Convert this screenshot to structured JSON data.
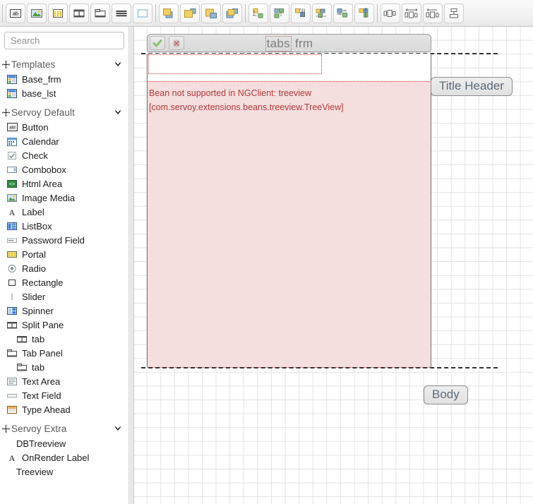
{
  "toolbar": {
    "groups": [
      {
        "name": "element-tools",
        "buttons": [
          {
            "name": "button-tool",
            "icon": "ab-button-icon",
            "label": "Button"
          },
          {
            "name": "image-tool",
            "icon": "image-media-icon",
            "label": "Image Media"
          },
          {
            "name": "portal-tool",
            "icon": "portal-icon",
            "label": "Portal"
          },
          {
            "name": "split-pane-tool",
            "icon": "split-pane-icon",
            "label": "Split Pane"
          },
          {
            "name": "tab-panel-tool",
            "icon": "tab-panel-icon",
            "label": "Tab Panel"
          },
          {
            "name": "text-area-tool",
            "icon": "text-area-icon",
            "label": "Text Area"
          }
        ]
      },
      {
        "name": "selection-tools",
        "buttons": [
          {
            "name": "rectangle-tool",
            "icon": "rectangle-icon",
            "label": "Rectangle"
          }
        ]
      },
      {
        "name": "z-order-tools",
        "buttons": [
          {
            "name": "bring-to-front-button",
            "icon": "bring-to-front-icon",
            "label": "Bring to front"
          },
          {
            "name": "bring-forward-button",
            "icon": "bring-forward-icon",
            "label": "Bring forward"
          },
          {
            "name": "send-backward-button",
            "icon": "send-backward-icon",
            "label": "Send backward"
          },
          {
            "name": "send-to-back-button",
            "icon": "send-to-back-icon",
            "label": "Send to back"
          }
        ]
      },
      {
        "name": "align-tools",
        "buttons": [
          {
            "name": "align-left-button",
            "icon": "align-left-icon",
            "label": "Align left"
          },
          {
            "name": "align-right-button",
            "icon": "align-right-icon",
            "label": "Align right"
          },
          {
            "name": "align-top-button",
            "icon": "align-top-icon",
            "label": "Align top"
          },
          {
            "name": "align-bottom-button",
            "icon": "align-bottom-icon",
            "label": "Align bottom"
          },
          {
            "name": "align-center-button",
            "icon": "align-center-icon",
            "label": "Align center"
          },
          {
            "name": "align-middle-button",
            "icon": "align-middle-icon",
            "label": "Align middle"
          }
        ]
      },
      {
        "name": "distribute-tools",
        "buttons": [
          {
            "name": "same-width-button",
            "icon": "same-width-icon",
            "label": "Same width"
          },
          {
            "name": "distribute-horizontal-button",
            "icon": "distribute-horizontal-icon",
            "label": "Distribute horizontally"
          },
          {
            "name": "horizontal-spacing-button",
            "icon": "horizontal-spacing-icon",
            "label": "Horizontal spacing"
          },
          {
            "name": "distribute-vertical-button",
            "icon": "distribute-vertical-icon",
            "label": "Distribute vertically"
          }
        ]
      }
    ]
  },
  "palette": {
    "search": {
      "placeholder": "Search",
      "value": ""
    },
    "groups": [
      {
        "label": "Templates",
        "expanded": true,
        "items": [
          {
            "label": "Base_frm",
            "icon": "template-form-icon"
          },
          {
            "label": "base_lst",
            "icon": "template-form-icon"
          }
        ]
      },
      {
        "label": "Servoy Default",
        "expanded": true,
        "items": [
          {
            "label": "Button",
            "icon": "ab-button-icon"
          },
          {
            "label": "Calendar",
            "icon": "calendar-icon"
          },
          {
            "label": "Check",
            "icon": "checkbox-icon"
          },
          {
            "label": "Combobox",
            "icon": "combobox-icon"
          },
          {
            "label": "Html Area",
            "icon": "html-area-icon"
          },
          {
            "label": "Image Media",
            "icon": "image-media-icon"
          },
          {
            "label": "Label",
            "icon": "label-a-icon"
          },
          {
            "label": "ListBox",
            "icon": "listbox-icon"
          },
          {
            "label": "Password Field",
            "icon": "password-field-icon"
          },
          {
            "label": "Portal",
            "icon": "portal-icon"
          },
          {
            "label": "Radio",
            "icon": "radio-icon"
          },
          {
            "label": "Rectangle",
            "icon": "rectangle-icon"
          },
          {
            "label": "Slider",
            "icon": "slider-icon"
          },
          {
            "label": "Spinner",
            "icon": "spinner-icon"
          },
          {
            "label": "Split Pane",
            "icon": "split-pane-icon"
          },
          {
            "label": "tab",
            "icon": "split-pane-icon",
            "indent": true
          },
          {
            "label": "Tab Panel",
            "icon": "tab-panel-icon"
          },
          {
            "label": "tab",
            "icon": "tab-panel-icon",
            "indent": true
          },
          {
            "label": "Text Area",
            "icon": "text-area-icon"
          },
          {
            "label": "Text Field",
            "icon": "text-field-icon"
          },
          {
            "label": "Type Ahead",
            "icon": "type-ahead-icon"
          }
        ]
      },
      {
        "label": "Servoy Extra",
        "expanded": true,
        "items": [
          {
            "label": "DBTreeview",
            "icon": "none",
            "indent": true
          },
          {
            "label": "OnRender Label",
            "icon": "label-a-icon"
          },
          {
            "label": "Treeview",
            "icon": "none",
            "indent": true
          }
        ]
      }
    ]
  },
  "editor": {
    "form_tab": {
      "title_prefix": "tabs",
      "title_suffix": "frm",
      "accept_icon": "check-mark-icon",
      "cancel_icon": "close-x-icon"
    },
    "title_field": {
      "value": ""
    },
    "bean": {
      "line1": "Bean not supported in NGClient: treeview",
      "line2": "[com.servoy.extensions.beans.treeview.TreeView]"
    },
    "parts": [
      {
        "name": "title-header",
        "label": "Title Header"
      },
      {
        "name": "body",
        "label": "Body"
      }
    ],
    "colors": {
      "bean_background": "#f5dede",
      "bean_text": "#b23a3a",
      "bean_border": "#c0392b",
      "grid_line": "#e2e2e2",
      "part_label_text": "#5d6b7a"
    }
  }
}
